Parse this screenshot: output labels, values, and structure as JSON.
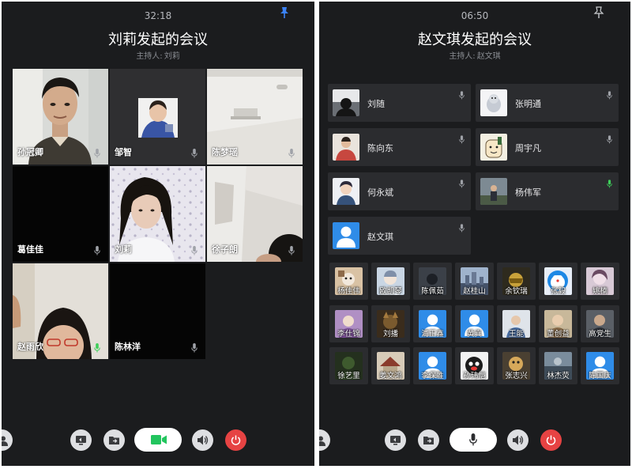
{
  "left": {
    "timer": "32:18",
    "title": "刘莉发起的会议",
    "host_label": "主持人:",
    "host_name": "刘莉",
    "tiles": [
      {
        "name": "孙冠卿"
      },
      {
        "name": "邹智"
      },
      {
        "name": "陈梦瑶"
      },
      {
        "name": "葛佳佳"
      },
      {
        "name": "刘莉"
      },
      {
        "name": "徐子朗"
      },
      {
        "name": "赵雨欣"
      },
      {
        "name": "陈林洋"
      }
    ]
  },
  "right": {
    "timer": "06:50",
    "title": "赵文琪发起的会议",
    "host_label": "主持人:",
    "host_name": "赵文琪",
    "speakers": [
      {
        "name": "刘随"
      },
      {
        "name": "张明通"
      },
      {
        "name": "陈向东"
      },
      {
        "name": "周宇凡"
      },
      {
        "name": "何永斌"
      },
      {
        "name": "杨伟军"
      },
      {
        "name": "赵文琪"
      }
    ],
    "attendees": [
      {
        "name": "杨佳伟"
      },
      {
        "name": "欧凯琴"
      },
      {
        "name": "陈佩茹"
      },
      {
        "name": "赵桂山"
      },
      {
        "name": "余钦瑞"
      },
      {
        "name": "张毅"
      },
      {
        "name": "姚楠"
      },
      {
        "name": "李仕锦"
      },
      {
        "name": "刘播"
      },
      {
        "name": "浦正鑫"
      },
      {
        "name": "黄真"
      },
      {
        "name": "王能"
      },
      {
        "name": "董创益"
      },
      {
        "name": "高党生"
      },
      {
        "name": "徐艺里"
      },
      {
        "name": "姜文鸿"
      },
      {
        "name": "李保胜"
      },
      {
        "name": "孙玮恺"
      },
      {
        "name": "张志兴"
      },
      {
        "name": "林杰荧"
      },
      {
        "name": "陈国庆"
      }
    ]
  },
  "colors": {
    "panel_bg": "#1b1c1e",
    "card_bg": "#2b2c2f",
    "accent_blue": "#2f8ce8",
    "camera_green": "#22c55e",
    "active_mic_green": "#3ecf5a",
    "hangup_red": "#e64343"
  },
  "icons": {
    "pin": "pin-icon",
    "mic": "mic-icon",
    "share_screen": "screen-share-icon",
    "share_file": "file-share-icon",
    "camera": "camera-icon",
    "speaker": "speaker-icon",
    "power": "power-icon",
    "person": "person-icon"
  }
}
